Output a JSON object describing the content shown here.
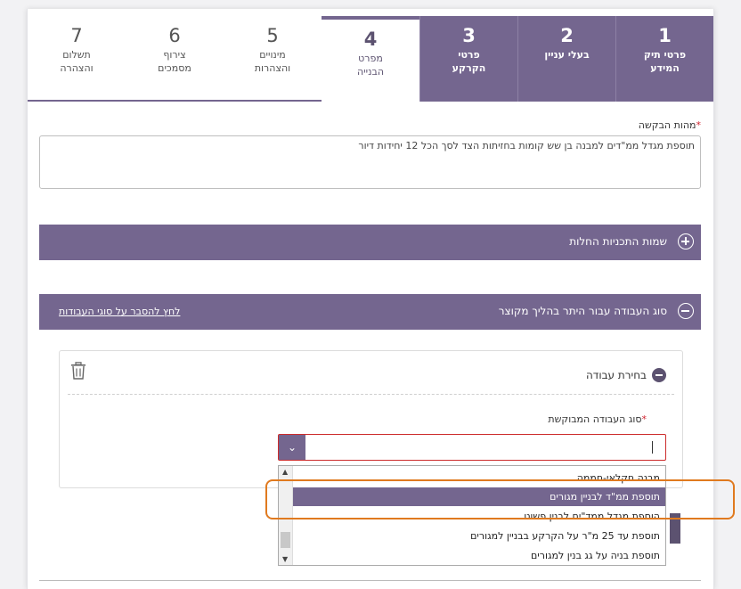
{
  "tabs": [
    {
      "num": "1",
      "label": "פרטי תיק המידע",
      "state": "done"
    },
    {
      "num": "2",
      "label": "בעלי עניין",
      "state": "done"
    },
    {
      "num": "3",
      "label": "פרטי הקרקע",
      "state": "done"
    },
    {
      "num": "4",
      "label": "מפרט הבנייה",
      "state": "active"
    },
    {
      "num": "5",
      "label": "מינויים והצהרות",
      "state": "future"
    },
    {
      "num": "6",
      "label": "צירוף מסמכים",
      "state": "future"
    },
    {
      "num": "7",
      "label": "תשלום והצהרה",
      "state": "future"
    }
  ],
  "request": {
    "label": "מהות הבקשה",
    "required_mark": "*",
    "value": "תוספת מגדל ממ\"דים למבנה בן שש קומות בחזיתות הצד לסך הכל 12 יחידות דיור"
  },
  "sections": {
    "plans_title": "שמות התכניות החלות",
    "work_type_title": "סוג העבודה עבור היתר בהליך מקוצר",
    "work_type_link": "לחץ להסבר על סוגי העבודות"
  },
  "work_card": {
    "title": "בחירת עבודה",
    "field_label": "סוג העבודה המבוקשת",
    "required_mark": "*",
    "arrow": "⌄"
  },
  "dropdown": {
    "options": [
      "מבנה חקלאי-חממה",
      "תוספת ממ\"ד לבניין מגורים",
      "הוספת מגדל ממד\"ים לבנין פשוט",
      "תוספת עד 25 מ\"ר על הקרקע בבניין למגורים",
      "תוספת בניה על גג בנין למגורים"
    ],
    "selected_index": 1,
    "highlighted_index": 2
  },
  "colors": {
    "accent": "#74668f",
    "highlight": "#e07a1f",
    "required": "#d0232f"
  }
}
